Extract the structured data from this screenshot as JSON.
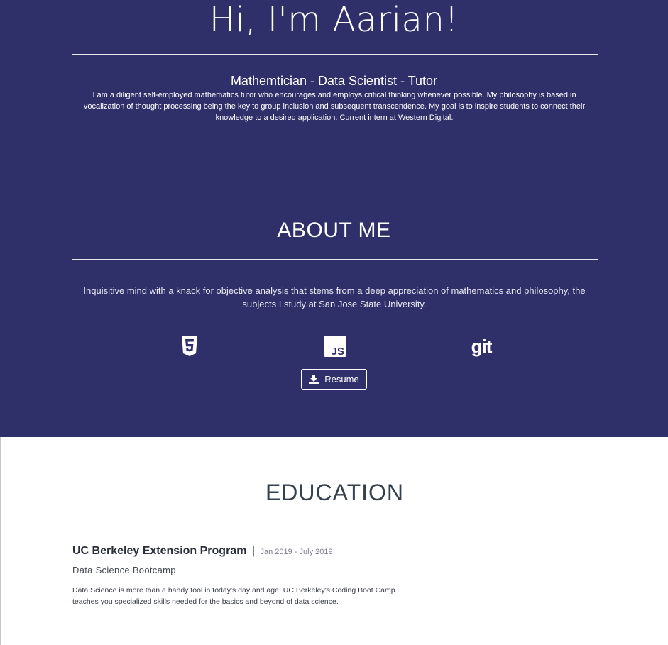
{
  "hero": {
    "title": "Hi, I'm Aarian!",
    "subtitle": "Mathemtician - Data Scientist - Tutor",
    "bio": "I am a diligent self-employed mathematics tutor who encourages and employs critical thinking whenever possible. My philosophy is based in vocalization of thought processing being the key to group inclusion and subsequent transcendence. My goal is to inspire students to connect their knowledge to a desired application. Current intern at Western Digital."
  },
  "about": {
    "title": "ABOUT ME",
    "text": "Inquisitive mind with a knack for objective analysis that stems from a deep appreciation of mathematics and philosophy, the subjects I study at San Jose State University.",
    "skills": [
      {
        "icon": "html5-icon"
      },
      {
        "icon": "javascript-icon",
        "label": "JS"
      },
      {
        "icon": "git-icon",
        "label": "git"
      }
    ],
    "resume_label": "Resume"
  },
  "education": {
    "title": "EDUCATION",
    "entries": [
      {
        "school": "UC Berkeley Extension Program",
        "separator": "|",
        "dates": "Jan 2019 - July 2019",
        "program": "Data Science Bootcamp",
        "description": "Data Science is more than a handy tool in today's day and age. UC Berkeley's Coding Boot Camp teaches you specialized skills needed for the basics and beyond of data science."
      }
    ]
  },
  "colors": {
    "hero_background": "#2f306a",
    "text_light": "#ffffff",
    "heading_dark": "#35404f"
  }
}
